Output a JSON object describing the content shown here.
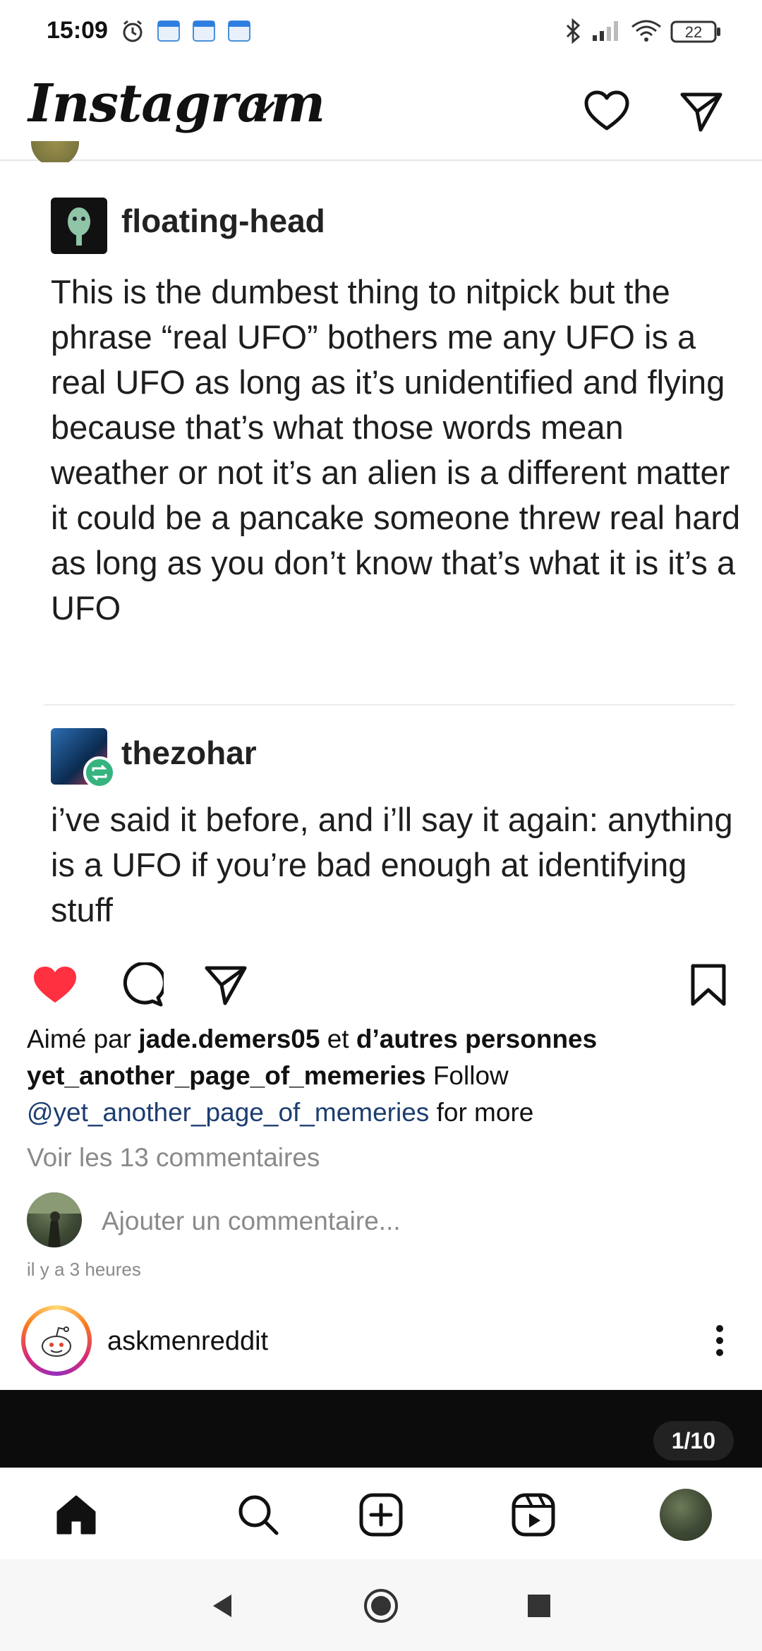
{
  "status_bar": {
    "time": "15:09",
    "battery": "22",
    "icons": [
      "alarm-icon",
      "calendar-icon",
      "calendar-icon",
      "calendar-icon",
      "bluetooth-icon",
      "signal-icon",
      "wifi-icon",
      "battery-icon"
    ]
  },
  "header": {
    "logo": "Instagram",
    "icons": [
      "chevron-down-icon",
      "heart-icon",
      "direct-message-icon"
    ]
  },
  "post": {
    "tumblr": {
      "op_username": "floating-head",
      "op_text": "This is the dumbest thing to nitpick but the phrase “real UFO” bothers me any UFO is a real UFO as long as it’s unidentified and flying because that’s what those words mean weather or not it’s an alien is a different matter it could be a pancake someone threw real hard as long as you don’t know that’s what it is it’s a UFO",
      "reblog_username": "thezohar",
      "reblog_text": "i’ve said it before, and i’ll say it again: anything is a UFO if you’re bad enough at identifying stuff"
    },
    "likes": {
      "prefix": "Aimé par",
      "user": "jade.demers05",
      "middle": "et",
      "others": "d’autres personnes"
    },
    "caption": {
      "username": "yet_another_page_of_memeries",
      "follow": "Follow",
      "mention": "@yet_another_page_of_memeries",
      "suffix": "for more"
    },
    "view_comments": "Voir les 13 commentaires",
    "comment_placeholder": "Ajouter un commentaire...",
    "time_ago": "il y a 3 heures",
    "liked": true
  },
  "next_post": {
    "username": "askmenreddit",
    "counter": "1/10"
  },
  "colors": {
    "like_red": "#ff3040",
    "mention_blue": "#1c3d70",
    "reblog_green": "#36b37e"
  }
}
